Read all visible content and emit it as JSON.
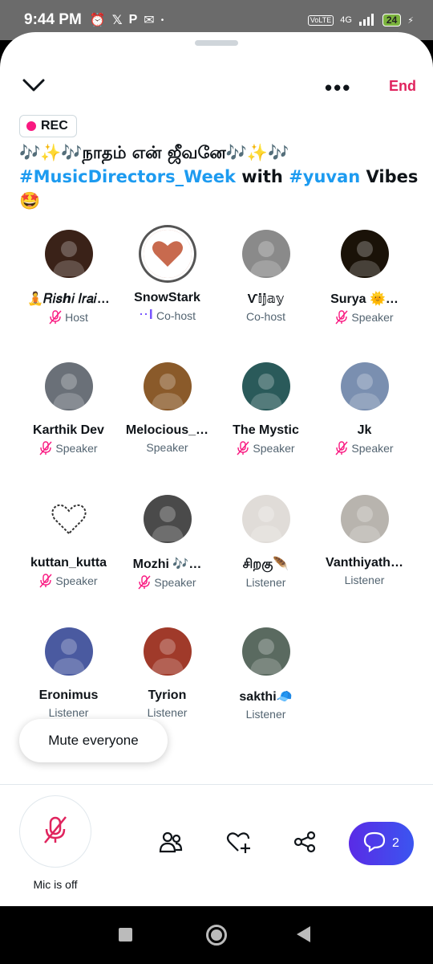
{
  "status_bar": {
    "time": "9:44 PM",
    "icons": [
      "alarm-icon",
      "x-icon",
      "p-icon",
      "mail-icon",
      "dot-icon"
    ],
    "volte": "VoLTE",
    "network": "4G",
    "battery": "24"
  },
  "header": {
    "end_label": "End",
    "rec_label": "REC"
  },
  "space": {
    "title_line1": "🎶✨🎶நாதம் என் ஜீவனே🎶✨🎶",
    "hashtag1": "#MusicDirectors_Week",
    "with_text": " with ",
    "hashtag2": "#yuvan",
    "vibes": " Vibes",
    "emoji": "🤩"
  },
  "participants": [
    {
      "name": "🧘𝑅𝑖𝑠ℎ𝑖 𝐼𝑟𝑎𝑖…",
      "role": "Host",
      "muted": true,
      "avatar_color": "#3a2218"
    },
    {
      "name": "SnowStark",
      "role": "Co-host",
      "muted": false,
      "speaking": true,
      "avatar_color": "#c86a4e"
    },
    {
      "name": "Ѵ𝕚𝕛𝕒𝕪",
      "role": "Co-host",
      "muted": false,
      "avatar_color": "#8a8a8a"
    },
    {
      "name": "Surya 🌞…",
      "role": "Speaker",
      "muted": true,
      "avatar_color": "#1a1208"
    },
    {
      "name": "Karthik Dev",
      "role": "Speaker",
      "muted": true,
      "avatar_color": "#6a7078"
    },
    {
      "name": "Melocious_…",
      "role": "Speaker",
      "muted": false,
      "avatar_color": "#8a5a2a"
    },
    {
      "name": "The Mystic",
      "role": "Speaker",
      "muted": true,
      "avatar_color": "#2a5a5a"
    },
    {
      "name": "Jk",
      "role": "Speaker",
      "muted": true,
      "avatar_color": "#7a8fb0"
    },
    {
      "name": "kuttan_kutta",
      "role": "Speaker",
      "muted": true,
      "avatar_color": "#ffffff"
    },
    {
      "name": "Mozhi 🎶…",
      "role": "Speaker",
      "muted": true,
      "avatar_color": "#4a4a4a"
    },
    {
      "name": "சிறகு🪶",
      "role": "Listener",
      "muted": false,
      "avatar_color": "#e0dcd8"
    },
    {
      "name": "Vanthiyath…",
      "role": "Listener",
      "muted": false,
      "avatar_color": "#b8b4ae"
    },
    {
      "name": "Eronimus",
      "role": "Listener",
      "muted": false,
      "avatar_color": "#4a5aa0"
    },
    {
      "name": "Tyrion",
      "role": "Listener",
      "muted": false,
      "avatar_color": "#a03a2a"
    },
    {
      "name": "sakthi🧢",
      "role": "Listener",
      "muted": false,
      "avatar_color": "#5a6a60"
    }
  ],
  "controls": {
    "mute_everyone": "Mute everyone",
    "mic_label": "Mic is off",
    "chat_count": "2"
  },
  "colors": {
    "accent_blue": "#1d9bf0",
    "end_red": "#e0245e",
    "rec_pink": "#f91880",
    "mute_pink": "#f91880",
    "chat_gradient_start": "#5a2be6",
    "chat_gradient_end": "#3b55f0"
  }
}
